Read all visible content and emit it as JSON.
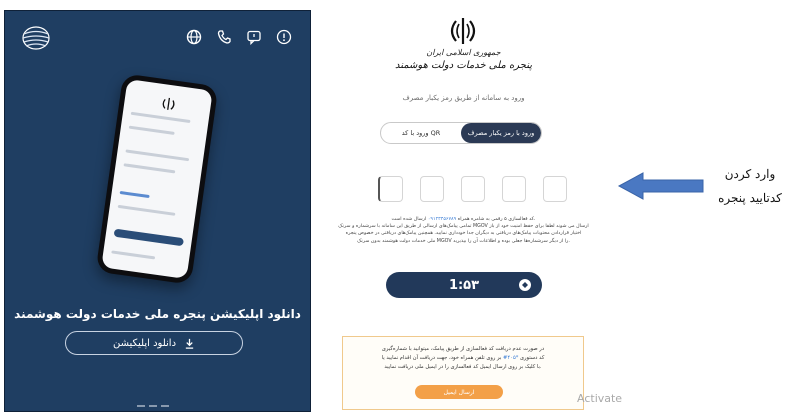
{
  "left_panel": {
    "app_title": "دانلود اپلیکیشن پنجره ملی خدمات دولت هوشمند",
    "download_button": "دانلود اپلیکیشن",
    "icons": [
      "globe-icon",
      "phone-icon",
      "chat-icon",
      "info-icon"
    ]
  },
  "right_panel": {
    "org_line1": "جمهوری اسلامی ایران",
    "org_line2": "پنجره ملی خدمات دولت هوشمند",
    "login_subtitle": "ورود به سامانه از طریق رمز یکبار مصرف",
    "tabs": [
      {
        "label": "ورود با رمز یکبار مصرف",
        "active": true
      },
      {
        "label": "ورود با کد QR",
        "active": false
      }
    ],
    "info_line1": "کد فعالسازی ۵ رقمی به شامره همراه ",
    "info_phone": "۰۹۱۲۳۴۵۶۷۸۹",
    "info_line1_end": " ارسال شده است.",
    "info_line2": "تمامی پیامک‌های ارسالی از طریق این سامانه با سرشماره و سرنک MGOV ارسال می شوند لطفا برای حفظ امنیت خود از باز",
    "info_line3": "اختیار قراردادن محتوبات پیامک‌های دریافتی به دیگران جدا خودداری نمایید. همچنین پیامک‌های دریافتی در خصوص پنجره",
    "info_line4": "ملی خدمات دولت هوشمند بدون سرنک MGOV را از دیگر سرشماره‌ها جعلی بوده و اطلاعات آن را بپذیرید.",
    "timer": "1:۵۳",
    "notice_line1": "در صورت عدم دریافت کد فعالسازی از طریق پیامک، میتوانید با شماره‌گیری",
    "notice_code": "*۴۰۵#",
    "notice_line2a": "کد دستوری ",
    "notice_line2b": " بر روی تلفن همراه خود، جهت دریافت آن اقدام نمایید یا",
    "notice_line3": "با کلیک بر روی ارسال ایمیل کد فعالسازی را در ایمیل ملی دریافت نمایید.",
    "email_button": "ارسال ایمیل",
    "watermark": "Activate"
  },
  "annotation": {
    "line1": "وارد کردن",
    "line2": "کدتایید پنجره"
  },
  "colors": {
    "left_bg": "#1f3e62",
    "timer_bg": "#22395a",
    "tab_active": "#2b3a55",
    "email_button": "#f3a048",
    "arrow": "#4a78c2"
  }
}
